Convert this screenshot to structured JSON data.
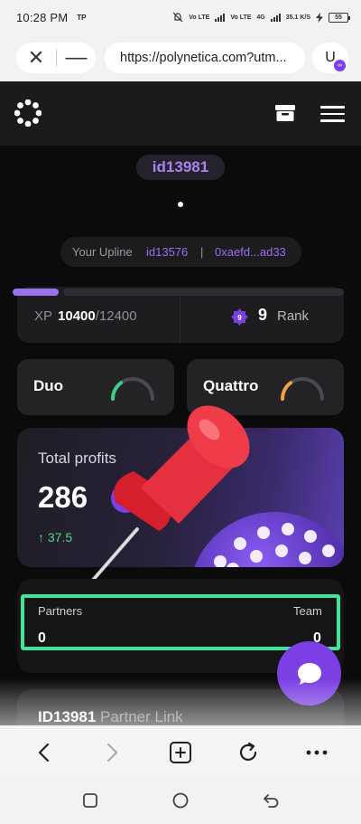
{
  "status_bar": {
    "time": "10:28 PM",
    "carrier_tag": "TP",
    "network_1": "Vo LTE",
    "network_2": "Vo LTE",
    "signal_type": "4G",
    "speed": "35.1 K/S",
    "battery": "55"
  },
  "browser": {
    "url": "https://polynetica.com?utm...",
    "profile_initial": "U"
  },
  "account": {
    "id": "id13981",
    "upline_label": "Your Upline",
    "upline_id": "id13576",
    "upline_separator": "|",
    "upline_address": "0xaefd...ad33"
  },
  "xp": {
    "label": "XP",
    "current": "10400",
    "separator": "/",
    "max": "12400",
    "progress_fraction": 0.14,
    "rank_badge": "9",
    "rank_value": "9",
    "rank_label": "Rank"
  },
  "programs": [
    {
      "name": "Duo",
      "color": "#3fcf86",
      "progress_fraction": 0.3
    },
    {
      "name": "Quattro",
      "color": "#f0a23c",
      "progress_fraction": 0.3
    }
  ],
  "profits": {
    "title": "Total profits",
    "value": "286",
    "change": "↑ 37.5"
  },
  "team": {
    "partners_label": "Partners",
    "partners_value": "0",
    "team_label": "Team",
    "team_value": "0",
    "highlight_color": "#3fe59b"
  },
  "partner_link": {
    "id": "ID13981",
    "label": "Partner Link"
  },
  "colors": {
    "accent": "#7b3fe4",
    "accent_text": "#9a6ff0",
    "positive": "#56d67e"
  },
  "icons": {
    "logo": "polynetica-logo-icon",
    "gift": "gift-box-icon",
    "menu": "hamburger-menu-icon",
    "rank": "rank-badge-icon",
    "token": "polygon-token-icon",
    "pin": "pushpin-sticker-icon",
    "chat": "chat-bubble-icon"
  }
}
